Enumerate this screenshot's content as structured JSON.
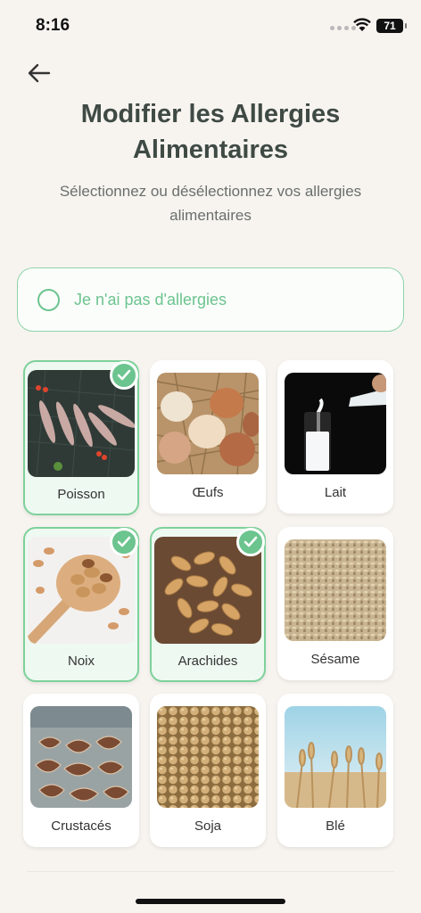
{
  "status": {
    "time": "8:16",
    "battery": "71"
  },
  "header": {
    "title_line1": "Modifier les Allergies",
    "title_line2": "Alimentaires",
    "subtitle_line1": "Sélectionnez ou désélectionnez vos allergies",
    "subtitle_line2": "alimentaires"
  },
  "no_allergy": {
    "label": "Je n'ai pas d'allergies",
    "checked": false
  },
  "allergens": [
    {
      "label": "Poisson",
      "selected": true,
      "icon": "fish-photo"
    },
    {
      "label": "Œufs",
      "selected": false,
      "icon": "eggs-photo"
    },
    {
      "label": "Lait",
      "selected": false,
      "icon": "milk-photo"
    },
    {
      "label": "Noix",
      "selected": true,
      "icon": "nuts-photo"
    },
    {
      "label": "Arachides",
      "selected": true,
      "icon": "peanuts-photo"
    },
    {
      "label": "Sésame",
      "selected": false,
      "icon": "sesame-photo"
    },
    {
      "label": "Crustacés",
      "selected": false,
      "icon": "shellfish-photo"
    },
    {
      "label": "Soja",
      "selected": false,
      "icon": "soy-photo"
    },
    {
      "label": "Blé",
      "selected": false,
      "icon": "wheat-photo"
    }
  ],
  "colors": {
    "accent": "#6cc48f",
    "background": "#f7f4f0",
    "title": "#3f4a44"
  }
}
